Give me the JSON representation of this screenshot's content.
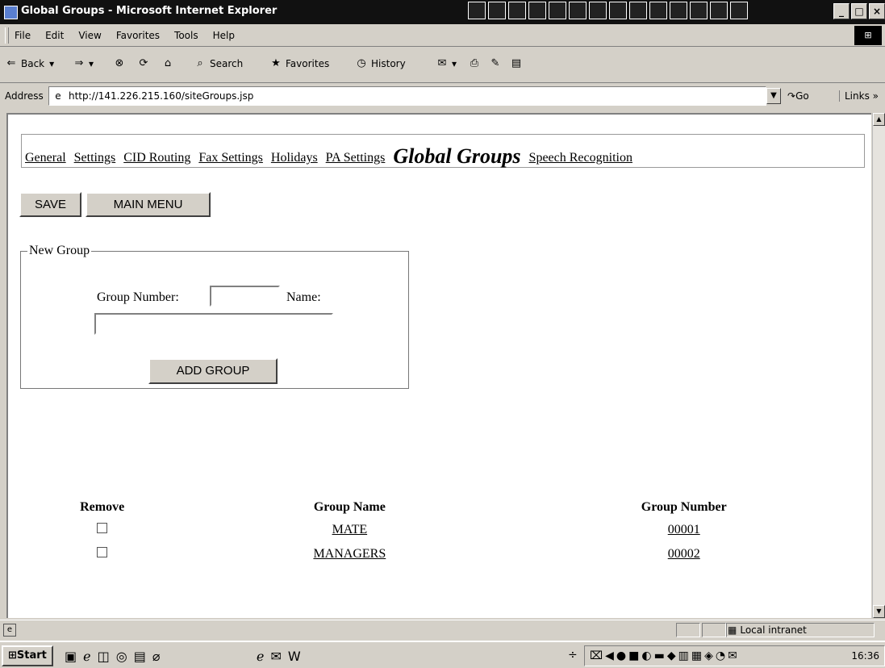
{
  "window": {
    "title": "Global Groups - Microsoft Internet Explorer"
  },
  "menu": [
    "File",
    "Edit",
    "View",
    "Favorites",
    "Tools",
    "Help"
  ],
  "toolbar": {
    "back": "Back",
    "search": "Search",
    "favorites": "Favorites",
    "history": "History"
  },
  "address": {
    "label": "Address",
    "url": "http://141.226.215.160/siteGroups.jsp",
    "go": "Go",
    "links": "Links"
  },
  "nav": {
    "links": [
      "General",
      "Settings",
      "CID Routing",
      "Fax Settings",
      "Holidays",
      "PA Settings"
    ],
    "current": "Global Groups",
    "after": "Speech Recognition"
  },
  "buttons": {
    "save": "SAVE",
    "main_menu": "MAIN MENU",
    "add_group": "ADD GROUP"
  },
  "new_group": {
    "legend": "New Group",
    "group_number_label": "Group Number:",
    "name_label": "Name:",
    "group_number_value": "",
    "name_value": ""
  },
  "table": {
    "headers": [
      "Remove",
      "Group Name",
      "Group Number"
    ],
    "rows": [
      {
        "name": "MATE",
        "number": "00001",
        "remove": false
      },
      {
        "name": "MANAGERS",
        "number": "00002",
        "remove": false
      }
    ]
  },
  "status": {
    "zone": "Local intranet"
  },
  "taskbar": {
    "start": "Start",
    "clock": "16:36"
  }
}
